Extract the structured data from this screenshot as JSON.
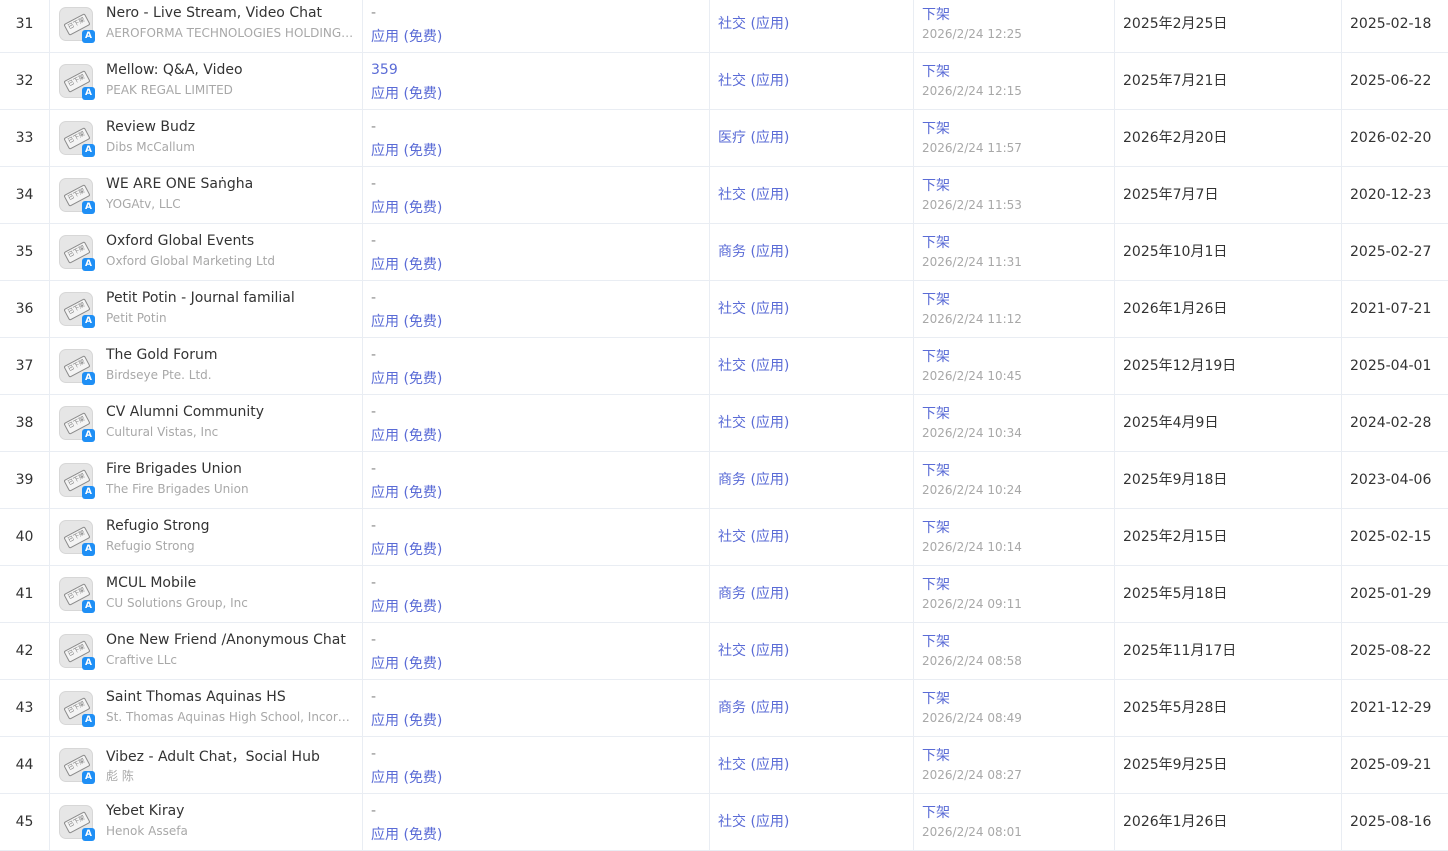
{
  "rows": [
    {
      "rank": "31",
      "name": "Nero - Live Stream, Video Chat",
      "developer": "AEROFORMA TECHNOLOGIES HOLDINGS ...",
      "downloads": "-",
      "price": "应用 (免费)",
      "category": "社交 (应用)",
      "status": "下架",
      "status_time": "2026/2/24 12:25",
      "release_date": "2025年2月25日",
      "update_date": "2025-02-18"
    },
    {
      "rank": "32",
      "name": "Mellow: Q&A, Video",
      "developer": "PEAK REGAL LIMITED",
      "downloads": "359",
      "price": "应用 (免费)",
      "category": "社交 (应用)",
      "status": "下架",
      "status_time": "2026/2/24 12:15",
      "release_date": "2025年7月21日",
      "update_date": "2025-06-22"
    },
    {
      "rank": "33",
      "name": "Review Budz",
      "developer": "Dibs McCallum",
      "downloads": "-",
      "price": "应用 (免费)",
      "category": "医疗 (应用)",
      "status": "下架",
      "status_time": "2026/2/24 11:57",
      "release_date": "2026年2月20日",
      "update_date": "2026-02-20"
    },
    {
      "rank": "34",
      "name": "WE ARE ONE Saṅgha",
      "developer": "YOGAtv, LLC",
      "downloads": "-",
      "price": "应用 (免费)",
      "category": "社交 (应用)",
      "status": "下架",
      "status_time": "2026/2/24 11:53",
      "release_date": "2025年7月7日",
      "update_date": "2020-12-23"
    },
    {
      "rank": "35",
      "name": "Oxford Global Events",
      "developer": "Oxford Global Marketing Ltd",
      "downloads": "-",
      "price": "应用 (免费)",
      "category": "商务 (应用)",
      "status": "下架",
      "status_time": "2026/2/24 11:31",
      "release_date": "2025年10月1日",
      "update_date": "2025-02-27"
    },
    {
      "rank": "36",
      "name": "Petit Potin - Journal familial",
      "developer": "Petit Potin",
      "downloads": "-",
      "price": "应用 (免费)",
      "category": "社交 (应用)",
      "status": "下架",
      "status_time": "2026/2/24 11:12",
      "release_date": "2026年1月26日",
      "update_date": "2021-07-21"
    },
    {
      "rank": "37",
      "name": "The Gold Forum",
      "developer": "Birdseye Pte. Ltd.",
      "downloads": "-",
      "price": "应用 (免费)",
      "category": "社交 (应用)",
      "status": "下架",
      "status_time": "2026/2/24 10:45",
      "release_date": "2025年12月19日",
      "update_date": "2025-04-01"
    },
    {
      "rank": "38",
      "name": "CV Alumni Community",
      "developer": "Cultural Vistas, Inc",
      "downloads": "-",
      "price": "应用 (免费)",
      "category": "社交 (应用)",
      "status": "下架",
      "status_time": "2026/2/24 10:34",
      "release_date": "2025年4月9日",
      "update_date": "2024-02-28"
    },
    {
      "rank": "39",
      "name": "Fire Brigades Union",
      "developer": "The Fire Brigades Union",
      "downloads": "-",
      "price": "应用 (免费)",
      "category": "商务 (应用)",
      "status": "下架",
      "status_time": "2026/2/24 10:24",
      "release_date": "2025年9月18日",
      "update_date": "2023-04-06"
    },
    {
      "rank": "40",
      "name": "Refugio Strong",
      "developer": "Refugio Strong",
      "downloads": "-",
      "price": "应用 (免费)",
      "category": "社交 (应用)",
      "status": "下架",
      "status_time": "2026/2/24 10:14",
      "release_date": "2025年2月15日",
      "update_date": "2025-02-15"
    },
    {
      "rank": "41",
      "name": "MCUL Mobile",
      "developer": "CU Solutions Group, Inc",
      "downloads": "-",
      "price": "应用 (免费)",
      "category": "商务 (应用)",
      "status": "下架",
      "status_time": "2026/2/24 09:11",
      "release_date": "2025年5月18日",
      "update_date": "2025-01-29"
    },
    {
      "rank": "42",
      "name": "One New Friend /Anonymous Chat",
      "developer": "Craftive LLc",
      "downloads": "-",
      "price": "应用 (免费)",
      "category": "社交 (应用)",
      "status": "下架",
      "status_time": "2026/2/24 08:58",
      "release_date": "2025年11月17日",
      "update_date": "2025-08-22"
    },
    {
      "rank": "43",
      "name": "Saint Thomas Aquinas HS",
      "developer": "St. Thomas Aquinas High School, Incorporat...",
      "downloads": "-",
      "price": "应用 (免费)",
      "category": "商务 (应用)",
      "status": "下架",
      "status_time": "2026/2/24 08:49",
      "release_date": "2025年5月28日",
      "update_date": "2021-12-29"
    },
    {
      "rank": "44",
      "name": "Vibez - Adult Chat，Social Hub",
      "developer": "彪 陈",
      "downloads": "-",
      "price": "应用 (免费)",
      "category": "社交 (应用)",
      "status": "下架",
      "status_time": "2026/2/24 08:27",
      "release_date": "2025年9月25日",
      "update_date": "2025-09-21"
    },
    {
      "rank": "45",
      "name": "Yebet Kiray",
      "developer": "Henok Assefa",
      "downloads": "-",
      "price": "应用 (免费)",
      "category": "社交 (应用)",
      "status": "下架",
      "status_time": "2026/2/24 08:01",
      "release_date": "2026年1月26日",
      "update_date": "2025-08-16"
    }
  ],
  "icons": {
    "app_icon": "removed-app-stamp-icon",
    "store_badge": "app-store-icon"
  }
}
